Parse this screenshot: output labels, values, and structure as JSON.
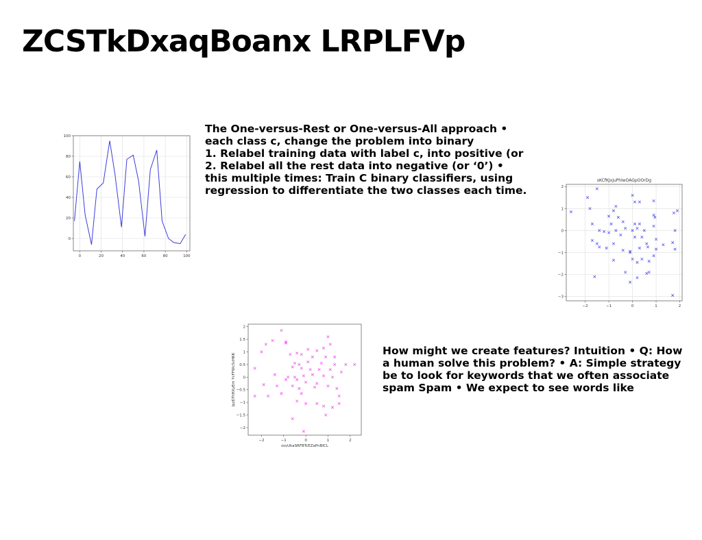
{
  "slide": {
    "title": "ZCSTkDxaqBoanx LRPLFVp"
  },
  "paragraph1": {
    "lines": [
      "The One-versus-Rest or One-versus-All approach •",
      "each class c, change the problem into binary",
      "1. Relabel training data with label c, into positive (or",
      "2. Relabel all the rest data into negative (or ‘0’) •",
      "this multiple times: Train C binary classifiers, using",
      "regression to differentiate the two classes each time."
    ]
  },
  "paragraph2": {
    "lines": [
      "How might we create features? Intuition • Q: How",
      "a human solve this problem? • A: Simple strategy",
      "be to look for keywords that we often associate",
      "spam Spam • We expect to see words like"
    ]
  },
  "chart_data": [
    {
      "type": "line",
      "title": "",
      "xlabel": "",
      "ylabel": "",
      "color": "#3b3bdd",
      "xlim": [
        -6,
        103
      ],
      "ylim": [
        -12,
        100
      ],
      "xticks": [
        0,
        20,
        40,
        60,
        80,
        100
      ],
      "yticks": [
        0,
        20,
        40,
        60,
        80,
        100
      ],
      "grid": true,
      "x": [
        -5,
        0,
        5,
        11,
        16,
        22,
        28,
        33,
        39,
        44,
        50,
        55,
        61,
        66,
        72,
        77,
        83,
        88,
        94,
        99
      ],
      "y": [
        17,
        75,
        23,
        -6,
        48,
        54,
        95,
        62,
        11,
        77,
        81,
        56,
        2,
        67,
        86,
        17,
        0,
        -4,
        -5,
        4
      ]
    },
    {
      "type": "scatter",
      "title": "sKCfKJxjuPhlwOAGpOOrDg",
      "xlabel": "",
      "ylabel": "",
      "color": "#5555ee",
      "marker": "x",
      "xlim": [
        -2.8,
        2.1
      ],
      "ylim": [
        -3.2,
        2.1
      ],
      "xticks": [
        -2,
        -1,
        0,
        1,
        2
      ],
      "yticks": [
        -3,
        -2,
        -1,
        0,
        1,
        2
      ],
      "grid": true,
      "points": [
        [
          -1.5,
          1.9
        ],
        [
          0.0,
          1.6
        ],
        [
          -1.9,
          1.5
        ],
        [
          0.1,
          1.3
        ],
        [
          0.3,
          1.3
        ],
        [
          0.9,
          1.35
        ],
        [
          -1.8,
          1.0
        ],
        [
          -0.7,
          1.1
        ],
        [
          -0.8,
          0.9
        ],
        [
          -2.6,
          0.85
        ],
        [
          1.9,
          0.9
        ],
        [
          1.75,
          0.8
        ],
        [
          -1.0,
          0.65
        ],
        [
          -0.6,
          0.6
        ],
        [
          0.9,
          0.7
        ],
        [
          0.95,
          0.6
        ],
        [
          -1.7,
          0.3
        ],
        [
          -0.9,
          0.3
        ],
        [
          -0.4,
          0.4
        ],
        [
          0.1,
          0.3
        ],
        [
          0.3,
          0.3
        ],
        [
          0.9,
          0.2
        ],
        [
          -1.4,
          0.0
        ],
        [
          -1.2,
          -0.05
        ],
        [
          -0.7,
          0.0
        ],
        [
          -0.3,
          0.1
        ],
        [
          0.0,
          0.0
        ],
        [
          0.2,
          0.1
        ],
        [
          0.5,
          0.0
        ],
        [
          -1.0,
          -0.1
        ],
        [
          -0.5,
          -0.2
        ],
        [
          0.1,
          -0.3
        ],
        [
          0.4,
          -0.3
        ],
        [
          1.0,
          -0.4
        ],
        [
          1.8,
          0.0
        ],
        [
          -1.7,
          -0.45
        ],
        [
          -1.5,
          -0.6
        ],
        [
          -1.4,
          -0.75
        ],
        [
          -0.8,
          -0.6
        ],
        [
          -0.4,
          -0.9
        ],
        [
          -0.1,
          -1.0
        ],
        [
          0.3,
          -0.8
        ],
        [
          0.6,
          -0.6
        ],
        [
          1.3,
          -0.65
        ],
        [
          1.7,
          -0.55
        ],
        [
          -1.1,
          -0.8
        ],
        [
          0.65,
          -0.75
        ],
        [
          1.0,
          -0.85
        ],
        [
          1.8,
          -0.85
        ],
        [
          -0.1,
          -0.95
        ],
        [
          0.0,
          -1.3
        ],
        [
          0.4,
          -1.3
        ],
        [
          0.7,
          -1.4
        ],
        [
          0.9,
          -1.15
        ],
        [
          -0.8,
          -1.35
        ],
        [
          0.2,
          -1.45
        ],
        [
          -0.3,
          -1.9
        ],
        [
          0.6,
          -1.95
        ],
        [
          0.7,
          -1.9
        ],
        [
          -1.6,
          -2.1
        ],
        [
          0.2,
          -2.15
        ],
        [
          -0.1,
          -2.35
        ],
        [
          1.7,
          -2.95
        ]
      ]
    },
    {
      "type": "scatter",
      "title": "",
      "xlabel": "ssvUkaSRFBTcEZaPnBICL",
      "ylabel": "lpzDTtHXyEm YcFFWcScHKK",
      "color": "#ee55ee",
      "marker": "x",
      "xlim": [
        -2.6,
        2.5
      ],
      "ylim": [
        -2.3,
        2.1
      ],
      "xticks": [
        -2,
        -1,
        0,
        1,
        2
      ],
      "yticks": [
        -2.0,
        -1.5,
        -1.0,
        -0.5,
        0.0,
        0.5,
        1.0,
        1.5,
        2.0
      ],
      "grid": false,
      "points": [
        [
          -1.1,
          1.85
        ],
        [
          -1.8,
          1.3
        ],
        [
          -1.5,
          1.45
        ],
        [
          -0.9,
          1.4
        ],
        [
          -0.9,
          1.35
        ],
        [
          1.0,
          1.6
        ],
        [
          1.1,
          1.3
        ],
        [
          0.1,
          1.1
        ],
        [
          0.5,
          1.05
        ],
        [
          0.8,
          1.15
        ],
        [
          -2.0,
          1.0
        ],
        [
          -0.4,
          0.95
        ],
        [
          -0.7,
          0.9
        ],
        [
          -0.2,
          0.9
        ],
        [
          0.3,
          0.8
        ],
        [
          0.9,
          0.8
        ],
        [
          1.3,
          0.8
        ],
        [
          -0.5,
          0.55
        ],
        [
          -0.3,
          0.5
        ],
        [
          0.1,
          0.6
        ],
        [
          0.7,
          0.55
        ],
        [
          1.3,
          0.5
        ],
        [
          1.8,
          0.5
        ],
        [
          2.2,
          0.5
        ],
        [
          -2.3,
          0.35
        ],
        [
          -0.6,
          0.4
        ],
        [
          -0.2,
          0.35
        ],
        [
          0.2,
          0.3
        ],
        [
          0.6,
          0.3
        ],
        [
          1.1,
          0.3
        ],
        [
          1.6,
          0.2
        ],
        [
          -1.4,
          0.1
        ],
        [
          -0.8,
          0.0
        ],
        [
          -0.5,
          0.0
        ],
        [
          -0.1,
          0.05
        ],
        [
          0.3,
          0.1
        ],
        [
          0.8,
          0.05
        ],
        [
          1.2,
          0.0
        ],
        [
          -0.9,
          -0.1
        ],
        [
          -0.4,
          -0.1
        ],
        [
          0.0,
          -0.2
        ],
        [
          0.5,
          -0.25
        ],
        [
          -1.9,
          -0.3
        ],
        [
          -1.3,
          -0.35
        ],
        [
          -0.6,
          -0.35
        ],
        [
          -0.3,
          -0.45
        ],
        [
          0.4,
          -0.4
        ],
        [
          1.0,
          -0.35
        ],
        [
          1.4,
          -0.45
        ],
        [
          -1.1,
          -0.65
        ],
        [
          -0.2,
          -0.65
        ],
        [
          1.5,
          -0.75
        ],
        [
          -2.3,
          -0.75
        ],
        [
          -1.7,
          -0.75
        ],
        [
          -0.4,
          -0.95
        ],
        [
          0.0,
          -1.05
        ],
        [
          0.5,
          -1.05
        ],
        [
          0.8,
          -1.15
        ],
        [
          1.2,
          -1.2
        ],
        [
          1.5,
          -1.05
        ],
        [
          0.9,
          -1.5
        ],
        [
          -0.6,
          -1.65
        ],
        [
          -0.1,
          -2.15
        ]
      ]
    }
  ]
}
